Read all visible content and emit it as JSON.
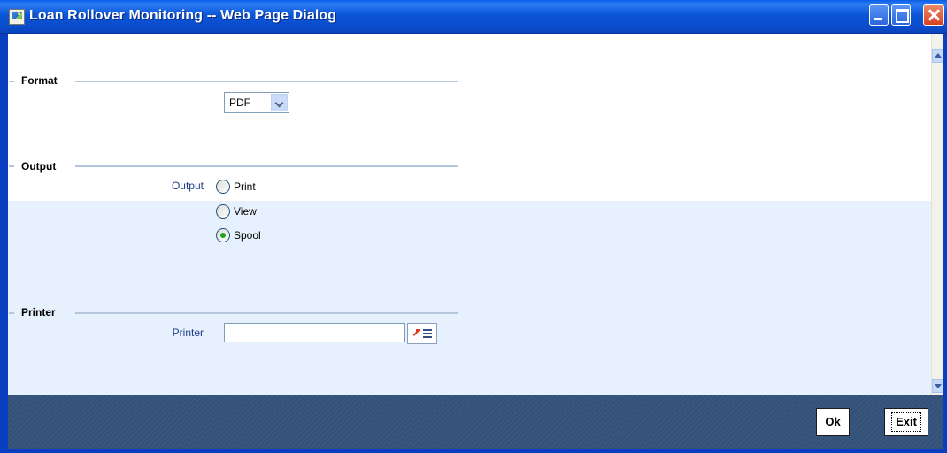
{
  "window": {
    "title": "Loan Rollover Monitoring -- Web Page Dialog"
  },
  "format_section": {
    "title": "Format",
    "select_value": "PDF"
  },
  "output_section": {
    "title": "Output",
    "label": "Output",
    "options": [
      {
        "label": "Print",
        "checked": false
      },
      {
        "label": "View",
        "checked": false
      },
      {
        "label": "Spool",
        "checked": true
      }
    ]
  },
  "printer_section": {
    "title": "Printer",
    "label": "Printer",
    "value": ""
  },
  "footer": {
    "ok_label": "Ok",
    "exit_label": "Exit"
  },
  "colors": {
    "titlebar": "#0a5ee8",
    "footer": "#34517a",
    "label_text": "#1d3c8a",
    "lower_panel": "#e7f1fd"
  },
  "icons": {
    "app": "web-dialog-icon",
    "lov": "list-of-values-icon"
  }
}
